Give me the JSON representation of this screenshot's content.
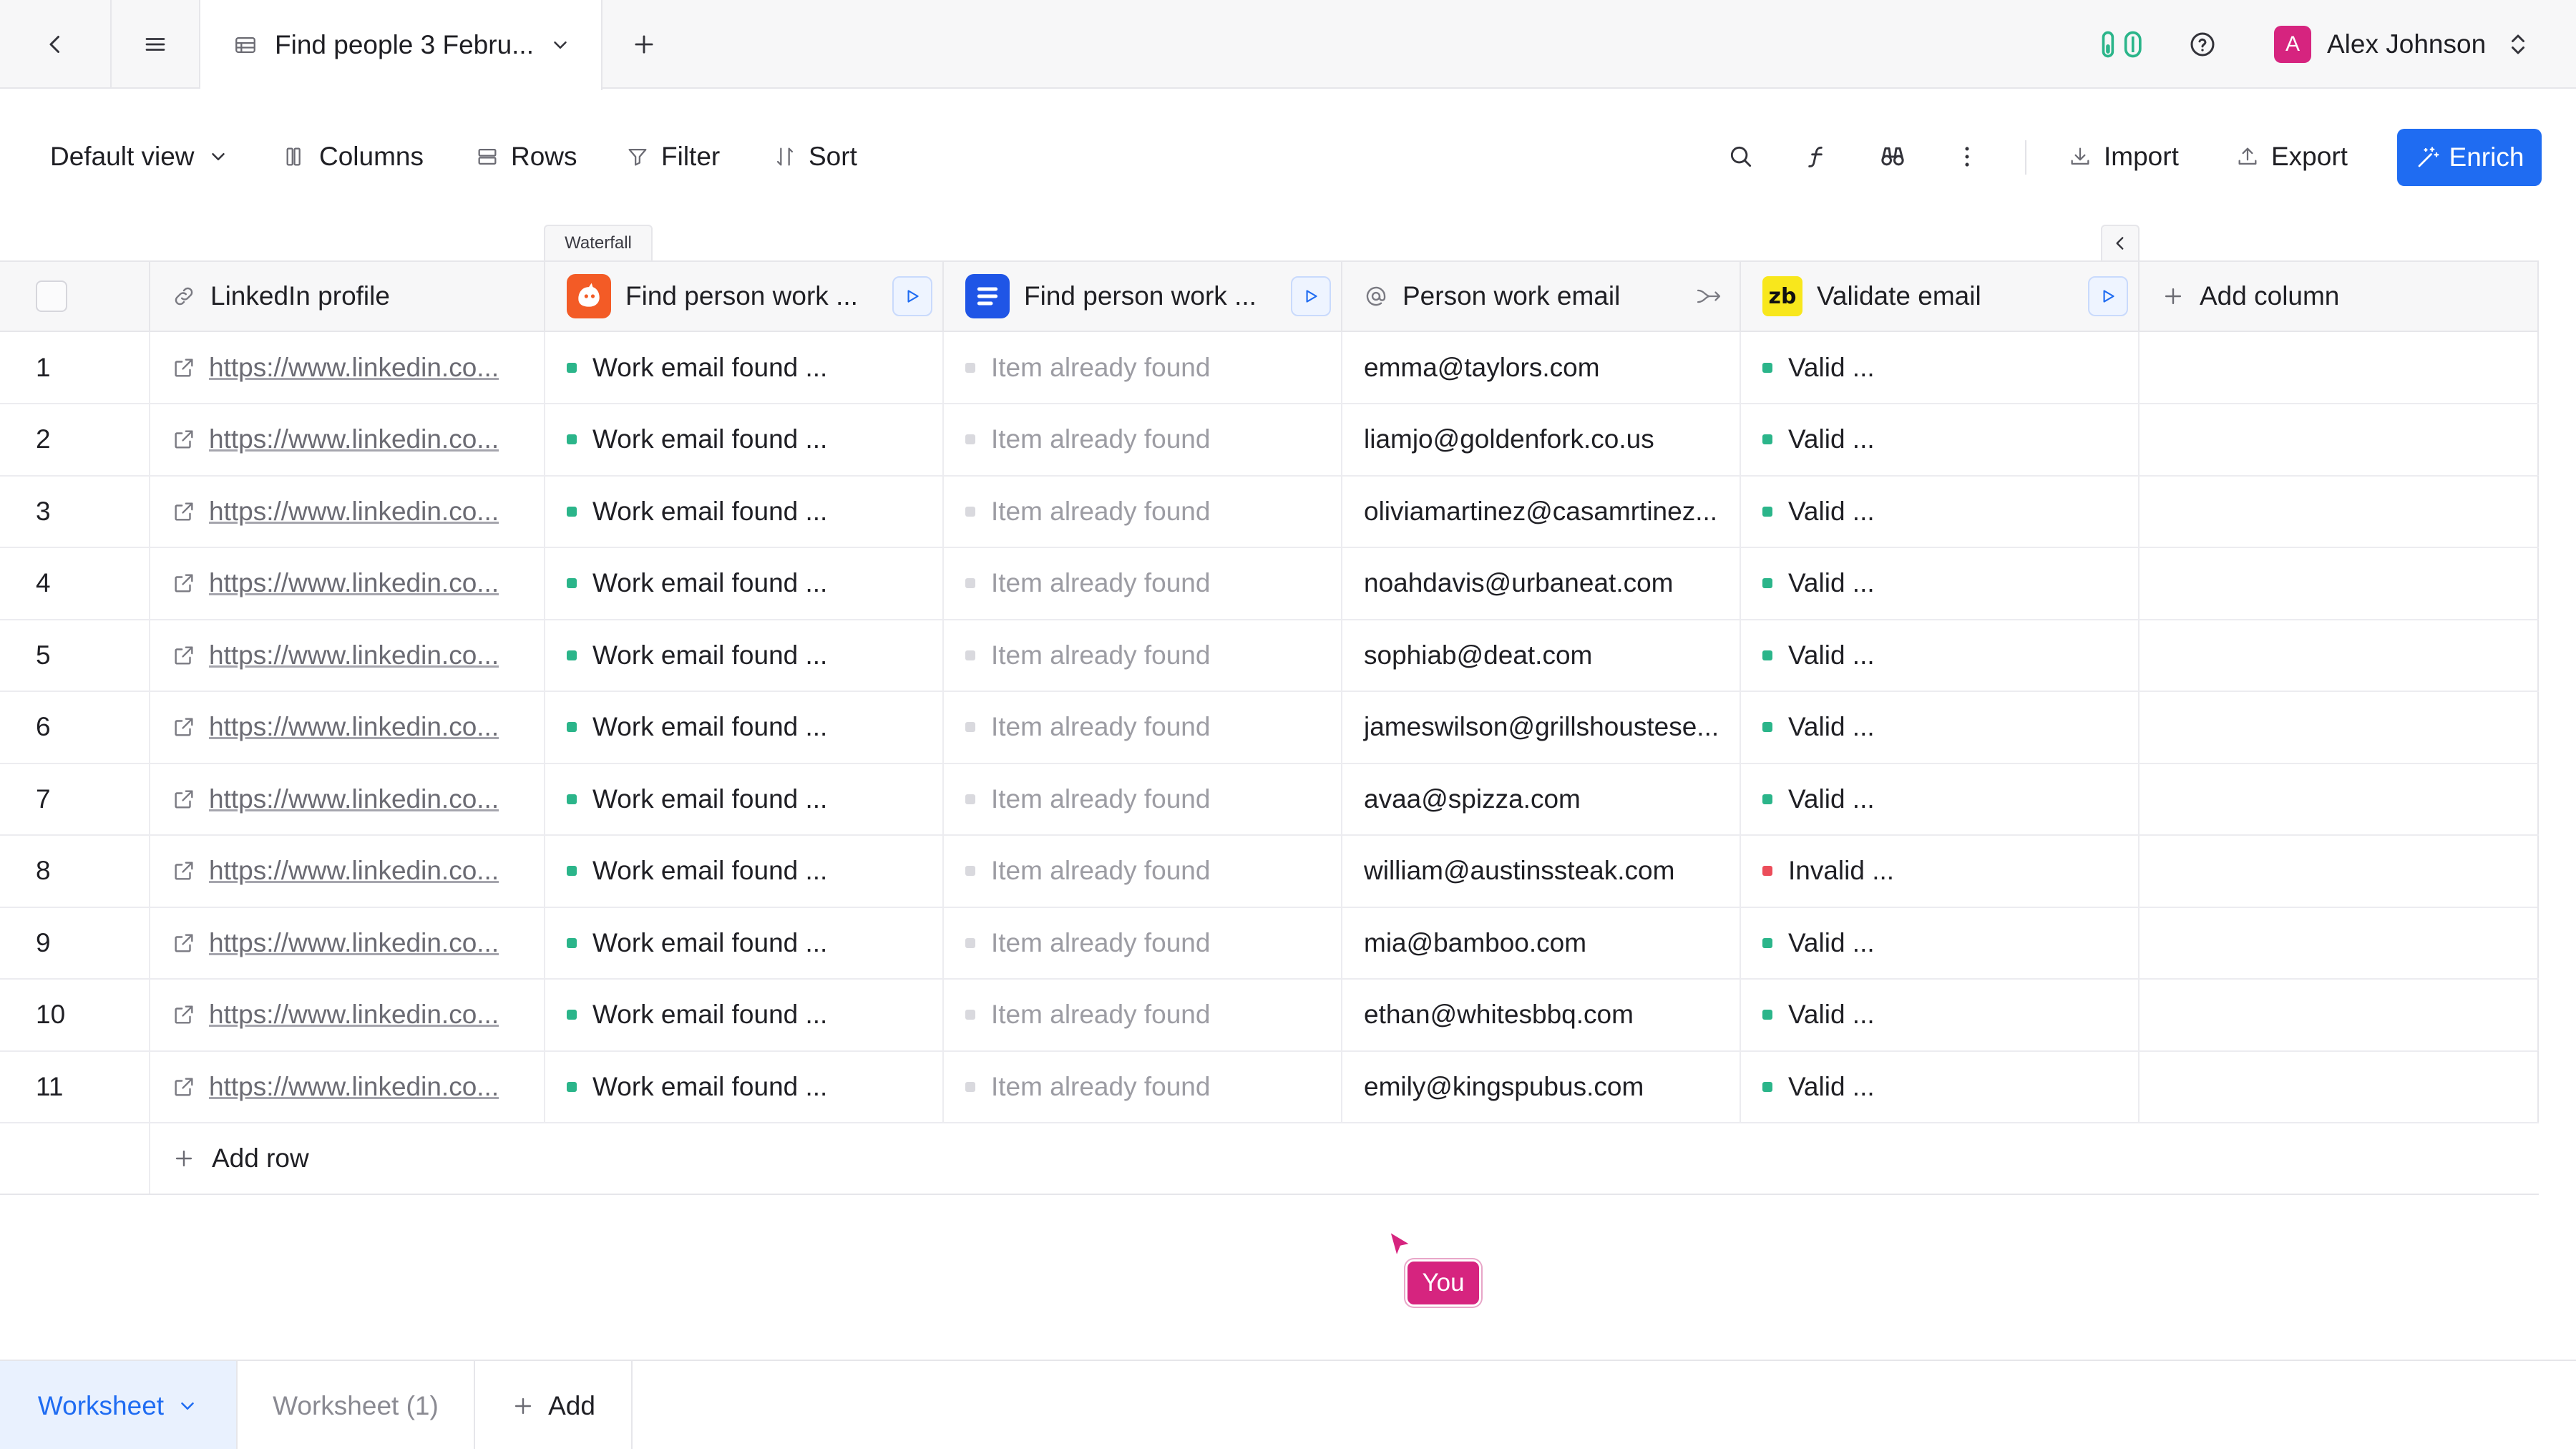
{
  "topbar": {
    "tab_title": "Find people 3 Febru...",
    "user_initial": "A",
    "user_name": "Alex Johnson"
  },
  "toolbar": {
    "view_label": "Default view",
    "columns_label": "Columns",
    "rows_label": "Rows",
    "filter_label": "Filter",
    "sort_label": "Sort",
    "import_label": "Import",
    "export_label": "Export",
    "enrich_label": "Enrich"
  },
  "waterfall_label": "Waterfall",
  "columns": [
    {
      "label": "LinkedIn profile",
      "icon": "link-icon"
    },
    {
      "label": "Find person work ...",
      "icon": "hunter-app-icon"
    },
    {
      "label": "Find person work ...",
      "icon": "blue-app-icon"
    },
    {
      "label": "Person work email",
      "icon": "at-icon"
    },
    {
      "label": "Validate email",
      "icon": "zerobounce-app-icon"
    },
    {
      "label": "Add column",
      "icon": "plus-icon"
    }
  ],
  "app_icons": {
    "zb_text": "zb"
  },
  "rows": [
    {
      "num": "1",
      "linkedin": "https://www.linkedin.co...",
      "find1": "Work email found ...",
      "find2": "Item already found",
      "email": "emma@taylors.com",
      "validate": "Valid ...",
      "status": "green"
    },
    {
      "num": "2",
      "linkedin": "https://www.linkedin.co...",
      "find1": "Work email found ...",
      "find2": "Item already found",
      "email": "liamjo@goldenfork.co.us",
      "validate": "Valid ...",
      "status": "green"
    },
    {
      "num": "3",
      "linkedin": "https://www.linkedin.co...",
      "find1": "Work email found ...",
      "find2": "Item already found",
      "email": "oliviamartinez@casamrtinez...",
      "validate": "Valid ...",
      "status": "green"
    },
    {
      "num": "4",
      "linkedin": "https://www.linkedin.co...",
      "find1": "Work email found ...",
      "find2": "Item already found",
      "email": "noahdavis@urbaneat.com",
      "validate": "Valid ...",
      "status": "green"
    },
    {
      "num": "5",
      "linkedin": "https://www.linkedin.co...",
      "find1": "Work email found ...",
      "find2": "Item already found",
      "email": "sophiab@deat.com",
      "validate": "Valid ...",
      "status": "green"
    },
    {
      "num": "6",
      "linkedin": "https://www.linkedin.co...",
      "find1": "Work email found ...",
      "find2": "Item already found",
      "email": "jameswilson@grillshoustese...",
      "validate": "Valid ...",
      "status": "green"
    },
    {
      "num": "7",
      "linkedin": "https://www.linkedin.co...",
      "find1": "Work email found ...",
      "find2": "Item already found",
      "email": "avaa@spizza.com",
      "validate": "Valid ...",
      "status": "green"
    },
    {
      "num": "8",
      "linkedin": "https://www.linkedin.co...",
      "find1": "Work email found ...",
      "find2": "Item already found",
      "email": "william@austinssteak.com",
      "validate": "Invalid ...",
      "status": "red"
    },
    {
      "num": "9",
      "linkedin": "https://www.linkedin.co...",
      "find1": "Work email found ...",
      "find2": "Item already found",
      "email": "mia@bamboo.com",
      "validate": "Valid ...",
      "status": "green"
    },
    {
      "num": "10",
      "linkedin": "https://www.linkedin.co...",
      "find1": "Work email found ...",
      "find2": "Item already found",
      "email": "ethan@whitesbbq.com",
      "validate": "Valid ...",
      "status": "green"
    },
    {
      "num": "11",
      "linkedin": "https://www.linkedin.co...",
      "find1": "Work email found ...",
      "find2": "Item already found",
      "email": "emily@kingspubus.com",
      "validate": "Valid ...",
      "status": "green"
    }
  ],
  "add_row_label": "Add row",
  "cursor_label": "You",
  "sheets": {
    "active": "Worksheet",
    "second": "Worksheet (1)",
    "add": "Add"
  },
  "colors": {
    "accent": "#1f6cf2",
    "avatar": "#d6247f",
    "valid": "#2bb58a",
    "invalid": "#ec4d5a",
    "hunter": "#f35b26"
  }
}
